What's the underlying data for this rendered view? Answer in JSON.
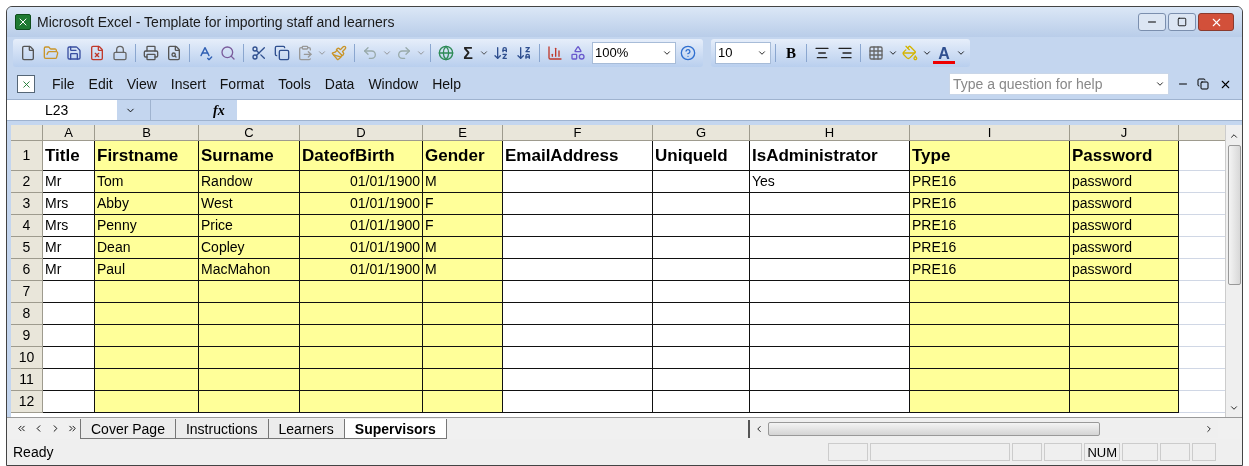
{
  "window": {
    "title": "Microsoft Excel - Template for importing staff and learners"
  },
  "toolbar": {
    "sum": "Σ",
    "zoom": "100%",
    "font_size": "10",
    "bold": "B",
    "font_color": "A"
  },
  "menu": [
    {
      "label": "File"
    },
    {
      "label": "Edit"
    },
    {
      "label": "View"
    },
    {
      "label": "Insert"
    },
    {
      "label": "Format"
    },
    {
      "label": "Tools"
    },
    {
      "label": "Data"
    },
    {
      "label": "Window"
    },
    {
      "label": "Help"
    }
  ],
  "help": {
    "placeholder": "Type a question for help"
  },
  "formula_bar": {
    "name_box": "L23",
    "fx": "fx"
  },
  "columns": [
    {
      "letter": "A",
      "color": "#ffffff",
      "kind": "text"
    },
    {
      "letter": "B",
      "color": "#ffff99",
      "kind": "text"
    },
    {
      "letter": "C",
      "color": "#ffff99",
      "kind": "text"
    },
    {
      "letter": "D",
      "color": "#ffff99",
      "kind": "date"
    },
    {
      "letter": "E",
      "color": "#ffff99",
      "kind": "text"
    },
    {
      "letter": "F",
      "color": "#ffffff",
      "kind": "text"
    },
    {
      "letter": "G",
      "color": "#ffffff",
      "kind": "text"
    },
    {
      "letter": "H",
      "color": "#ffffff",
      "kind": "text"
    },
    {
      "letter": "I",
      "color": "#ffff99",
      "kind": "text"
    },
    {
      "letter": "J",
      "color": "#ffff99",
      "kind": "text"
    }
  ],
  "rows": [
    {
      "number": "1",
      "kind": "header",
      "cells": {
        "A": "Title",
        "B": "Firstname",
        "C": "Surname",
        "D": "DateofBirth",
        "E": "Gender",
        "F": "EmailAddress",
        "G": "UniqueId",
        "H": "IsAdministrator",
        "I": "Type",
        "J": "Password"
      }
    },
    {
      "number": "2",
      "kind": "data",
      "cells": {
        "A": "Mr",
        "B": "Tom",
        "C": "Randow",
        "D": "01/01/1900",
        "E": "M",
        "H": "Yes",
        "I": "PRE16",
        "J": "password"
      }
    },
    {
      "number": "3",
      "kind": "data",
      "cells": {
        "A": "Mrs",
        "B": "Abby",
        "C": "West",
        "D": "01/01/1900",
        "E": "F",
        "I": "PRE16",
        "J": "password"
      }
    },
    {
      "number": "4",
      "kind": "data",
      "cells": {
        "A": "Mrs",
        "B": "Penny",
        "C": "Price",
        "D": "01/01/1900",
        "E": "F",
        "I": "PRE16",
        "J": "password"
      }
    },
    {
      "number": "5",
      "kind": "data",
      "cells": {
        "A": "Mr",
        "B": "Dean",
        "C": "Copley",
        "D": "01/01/1900",
        "E": "M",
        "I": "PRE16",
        "J": "password"
      }
    },
    {
      "number": "6",
      "kind": "data",
      "cells": {
        "A": "Mr",
        "B": "Paul",
        "C": "MacMahon",
        "D": "01/01/1900",
        "E": "M",
        "I": "PRE16",
        "J": "password"
      }
    },
    {
      "number": "7",
      "kind": "data",
      "cells": {}
    },
    {
      "number": "8",
      "kind": "data",
      "cells": {}
    },
    {
      "number": "9",
      "kind": "data",
      "cells": {}
    },
    {
      "number": "10",
      "kind": "data",
      "cells": {}
    },
    {
      "number": "11",
      "kind": "data",
      "cells": {}
    },
    {
      "number": "12",
      "kind": "data",
      "cells": {}
    }
  ],
  "sheet_tabs": [
    {
      "label": "Cover Page",
      "selected": false
    },
    {
      "label": "Instructions",
      "selected": false
    },
    {
      "label": "Learners",
      "selected": false
    },
    {
      "label": "Supervisors",
      "selected": true
    }
  ],
  "status_bar": {
    "text": "Ready",
    "num": "NUM"
  }
}
